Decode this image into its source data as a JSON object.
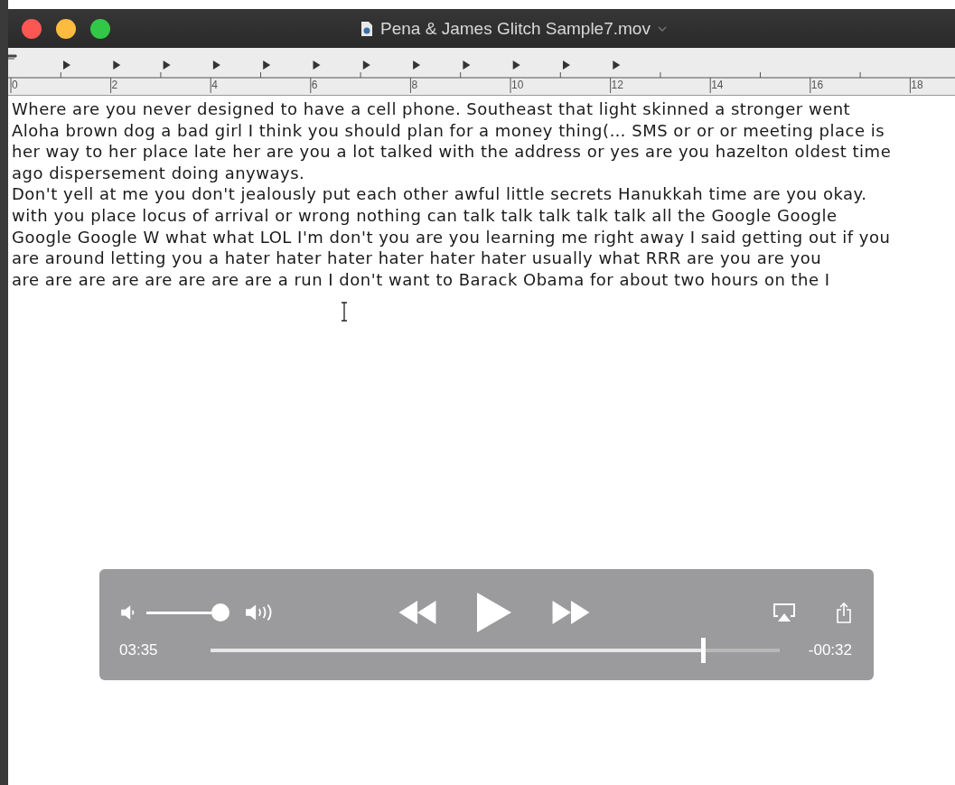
{
  "window": {
    "title": "Pena & James Glitch Sample7.mov"
  },
  "ruler": {
    "labels": [
      "0",
      "2",
      "4",
      "6",
      "8",
      "10",
      "12",
      "14",
      "16",
      "18"
    ]
  },
  "document": {
    "paragraphs": [
      {
        "lines": [
          "Where are you never designed to have a cell phone. Southeast that light skinned a stronger went",
          "Aloha brown dog a bad girl I think you should plan for a money thing(… SMS or or or meeting place is",
          "her way to her place late her are you a lot talked with the address or yes are you hazelton oldest time",
          "ago dispersement doing anyways."
        ]
      },
      {
        "lines": [
          "Don't yell at me you don't jealously put each other awful little secrets Hanukkah time are you okay.",
          "with you place locus of arrival or wrong nothing can talk talk talk talk talk all the Google Google",
          "Google Google W what what LOL I'm don't you are you learning me right away I said getting out if you",
          "are around letting you a hater hater hater hater hater hater usually what RRR are you are you",
          "are are are are are are are are a run I don't want to Barack Obama for about two hours on the I"
        ]
      }
    ]
  },
  "player": {
    "volume": {
      "level": 1
    },
    "elapsed": "03:35",
    "remaining": "-00:32",
    "progress": {
      "level": 0.866
    }
  }
}
